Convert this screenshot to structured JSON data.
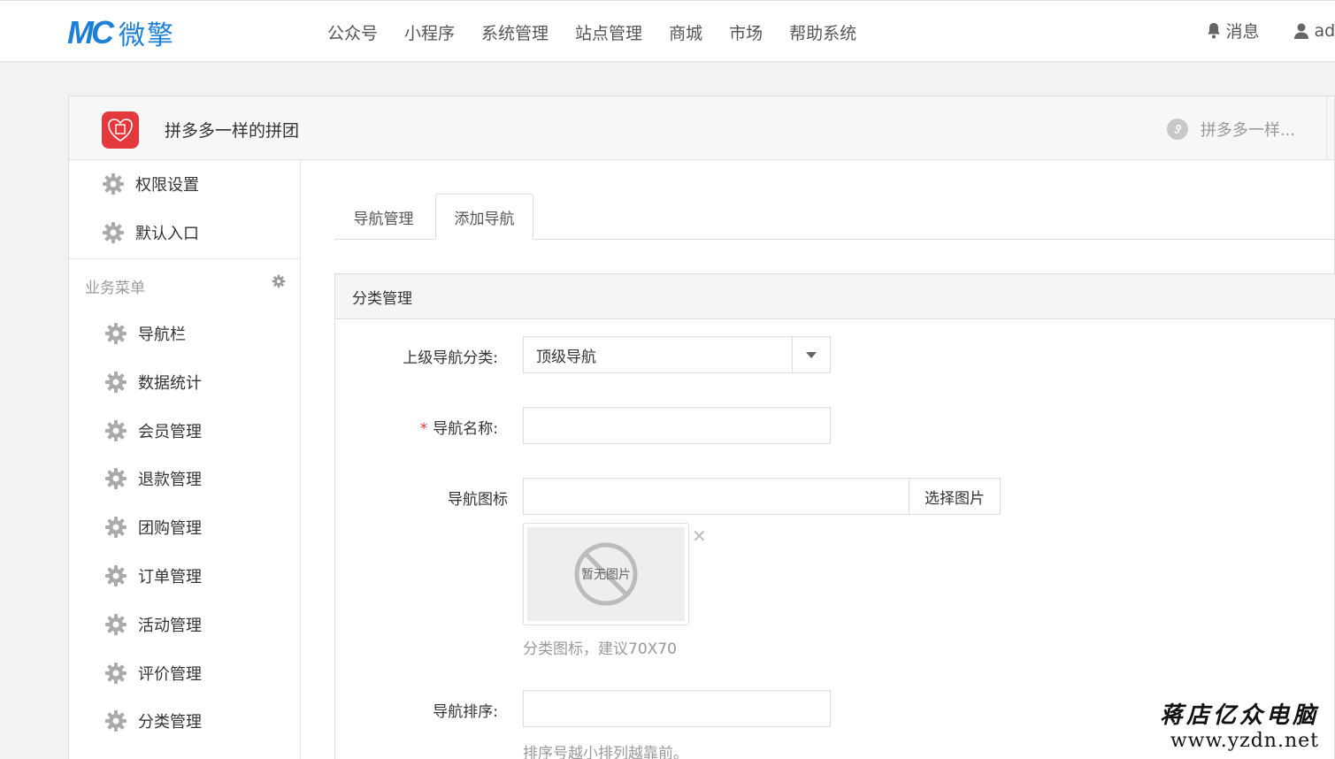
{
  "logo": {
    "mark": "MC",
    "text": "微擎"
  },
  "topnav": [
    "公众号",
    "小程序",
    "系统管理",
    "站点管理",
    "商城",
    "市场",
    "帮助系统"
  ],
  "top_right": {
    "messages": "消息",
    "user": "adr"
  },
  "app": {
    "name": "拼多多一样的拼团",
    "switcher": "拼多多一样..."
  },
  "sidebar": {
    "top_items": [
      "权限设置",
      "默认入口"
    ],
    "section_title": "业务菜单",
    "items": [
      "导航栏",
      "数据统计",
      "会员管理",
      "退款管理",
      "团购管理",
      "订单管理",
      "活动管理",
      "评价管理",
      "分类管理"
    ]
  },
  "tabs": [
    "导航管理",
    "添加导航"
  ],
  "panel": {
    "title": "分类管理",
    "parent_label": "上级导航分类:",
    "parent_value": "顶级导航",
    "name_label": "导航名称:",
    "icon_label": "导航图标",
    "choose_button": "选择图片",
    "no_image": "暂无图片",
    "icon_hint": "分类图标，建议70X70",
    "sort_label": "导航排序:",
    "sort_hint": "排序号越小排列越靠前。"
  },
  "watermark": {
    "name": "蒋店亿众电脑",
    "url": "www.yzdn.net"
  },
  "colors": {
    "brand": "#1e7fd6",
    "app_icon": "#e4393c"
  }
}
